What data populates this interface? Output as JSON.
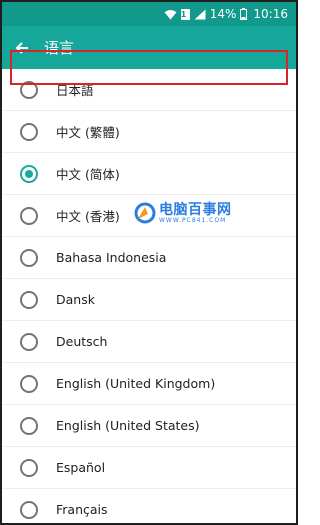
{
  "status_bar": {
    "battery": "14%",
    "time": "10:16",
    "sim_label": "1",
    "icons": [
      "wifi-icon",
      "sim-icon",
      "signal-icon",
      "battery-icon"
    ]
  },
  "app_bar": {
    "title": "语言",
    "back_icon": "arrow-left-icon"
  },
  "languages": [
    {
      "label": "日本語",
      "selected": false
    },
    {
      "label": "中文 (繁體)",
      "selected": false
    },
    {
      "label": "中文 (简体)",
      "selected": true
    },
    {
      "label": "中文 (香港)",
      "selected": false
    },
    {
      "label": "Bahasa Indonesia",
      "selected": false
    },
    {
      "label": "Dansk",
      "selected": false
    },
    {
      "label": "Deutsch",
      "selected": false
    },
    {
      "label": "English (United Kingdom)",
      "selected": false
    },
    {
      "label": "English (United States)",
      "selected": false
    },
    {
      "label": "Español",
      "selected": false
    },
    {
      "label": "Français",
      "selected": false
    }
  ],
  "watermark": {
    "main": "电脑百事网",
    "sub": "WWW.PC841.COM"
  },
  "colors": {
    "status_bar": "#11998b",
    "app_bar": "#15a89a",
    "accent": "#1aa99b",
    "highlight": "#d8252a",
    "watermark": "#2a7de1"
  }
}
